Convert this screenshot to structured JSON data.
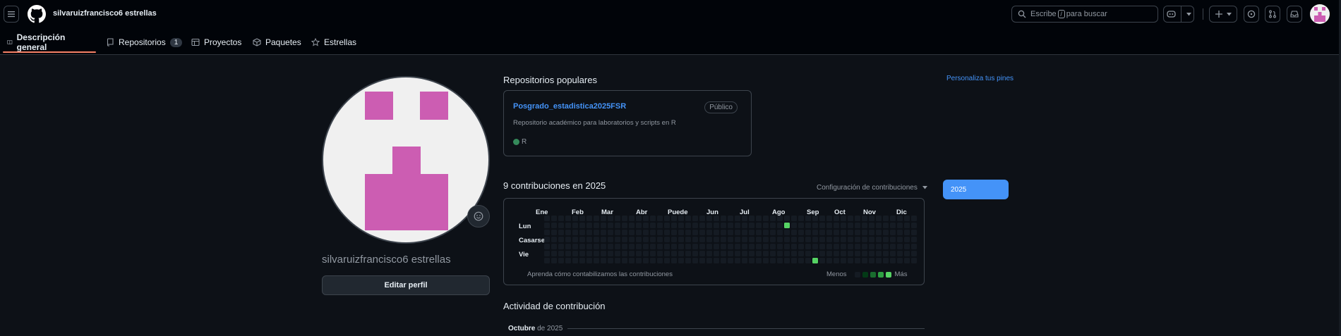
{
  "header": {
    "user_crumb": "silvaruizfrancisco6 estrellas",
    "search_prefix": "Escribe",
    "search_key": "/",
    "search_suffix": "para buscar"
  },
  "tabs": [
    {
      "label": "Descripción general",
      "icon": "book-icon",
      "active": true
    },
    {
      "label": "Repositorios",
      "icon": "repo-icon",
      "count": "1"
    },
    {
      "label": "Proyectos",
      "icon": "table-icon"
    },
    {
      "label": "Paquetes",
      "icon": "package-icon"
    },
    {
      "label": "Estrellas",
      "icon": "star-icon"
    }
  ],
  "profile": {
    "name": "silvaruizfrancisco6 estrellas",
    "edit_label": "Editar perfil",
    "avatar_color": "#cc5db2"
  },
  "popular": {
    "title": "Repositorios populares",
    "customize_label": "Personaliza tus pines",
    "repo": {
      "name": "Posgrado_estadistica2025FSR",
      "visibility": "Público",
      "description": "Repositorio académico para laboratorios y scripts en R",
      "language": "R",
      "language_color": "#358a5b"
    }
  },
  "contributions": {
    "title": "9 contribuciones en 2025",
    "settings_label": "Configuración de contribuciones",
    "year": "2025",
    "months": [
      "Ene",
      "Feb",
      "Mar",
      "Abr",
      "Puede",
      "Jun",
      "Jul",
      "Ago",
      "Sep",
      "Oct",
      "Nov",
      "Dic"
    ],
    "day_labels": [
      "Lun",
      "Casarse",
      "Vie"
    ],
    "learn_label": "Aprenda cómo contabilizamos las contribuciones",
    "less_label": "Menos",
    "more_label": "Más",
    "empty_color": "#151b23",
    "level_colors": [
      "#151b23",
      "#033a16",
      "#196c2e",
      "#2ea043",
      "#56d364"
    ],
    "active_cells": [
      {
        "week": 34,
        "day": 1,
        "level": 4
      },
      {
        "week": 38,
        "day": 6,
        "level": 4
      }
    ]
  },
  "activity": {
    "title": "Actividad de contribución",
    "month": "Octubre",
    "year_suffix": "de 2025"
  }
}
